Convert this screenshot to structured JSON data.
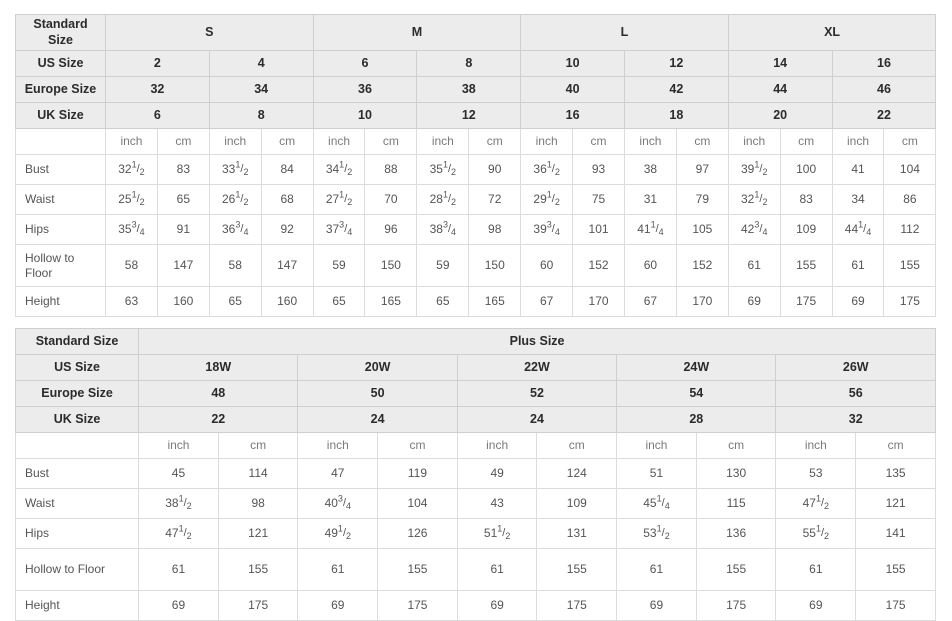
{
  "tables": [
    {
      "id": "standard-size-table",
      "row_label_header": "Standard Size",
      "groups": [
        {
          "label": "S",
          "span": 4
        },
        {
          "label": "M",
          "span": 4
        },
        {
          "label": "L",
          "span": 4
        },
        {
          "label": "XL",
          "span": 4
        }
      ],
      "size_rows": [
        {
          "label": "US Size",
          "values": [
            "2",
            "4",
            "6",
            "8",
            "10",
            "12",
            "14",
            "16"
          ]
        },
        {
          "label": "Europe Size",
          "values": [
            "32",
            "34",
            "36",
            "38",
            "40",
            "42",
            "44",
            "46"
          ]
        },
        {
          "label": "UK Size",
          "values": [
            "6",
            "8",
            "10",
            "12",
            "16",
            "18",
            "20",
            "22"
          ]
        }
      ],
      "units": [
        "inch",
        "cm",
        "inch",
        "cm",
        "inch",
        "cm",
        "inch",
        "cm",
        "inch",
        "cm",
        "inch",
        "cm",
        "inch",
        "cm",
        "inch",
        "cm"
      ],
      "measure_rows": [
        {
          "label": "Bust",
          "values": [
            {
              "w": "32",
              "n": "1",
              "d": "2"
            },
            {
              "w": "83"
            },
            {
              "w": "33",
              "n": "1",
              "d": "2"
            },
            {
              "w": "84"
            },
            {
              "w": "34",
              "n": "1",
              "d": "2"
            },
            {
              "w": "88"
            },
            {
              "w": "35",
              "n": "1",
              "d": "2"
            },
            {
              "w": "90"
            },
            {
              "w": "36",
              "n": "1",
              "d": "2"
            },
            {
              "w": "93"
            },
            {
              "w": "38"
            },
            {
              "w": "97"
            },
            {
              "w": "39",
              "n": "1",
              "d": "2"
            },
            {
              "w": "100"
            },
            {
              "w": "41"
            },
            {
              "w": "104"
            }
          ]
        },
        {
          "label": "Waist",
          "values": [
            {
              "w": "25",
              "n": "1",
              "d": "2"
            },
            {
              "w": "65"
            },
            {
              "w": "26",
              "n": "1",
              "d": "2"
            },
            {
              "w": "68"
            },
            {
              "w": "27",
              "n": "1",
              "d": "2"
            },
            {
              "w": "70"
            },
            {
              "w": "28",
              "n": "1",
              "d": "2"
            },
            {
              "w": "72"
            },
            {
              "w": "29",
              "n": "1",
              "d": "2"
            },
            {
              "w": "75"
            },
            {
              "w": "31"
            },
            {
              "w": "79"
            },
            {
              "w": "32",
              "n": "1",
              "d": "2"
            },
            {
              "w": "83"
            },
            {
              "w": "34"
            },
            {
              "w": "86"
            }
          ]
        },
        {
          "label": "Hips",
          "values": [
            {
              "w": "35",
              "n": "3",
              "d": "4"
            },
            {
              "w": "91"
            },
            {
              "w": "36",
              "n": "3",
              "d": "4"
            },
            {
              "w": "92"
            },
            {
              "w": "37",
              "n": "3",
              "d": "4"
            },
            {
              "w": "96"
            },
            {
              "w": "38",
              "n": "3",
              "d": "4"
            },
            {
              "w": "98"
            },
            {
              "w": "39",
              "n": "3",
              "d": "4"
            },
            {
              "w": "101"
            },
            {
              "w": "41",
              "n": "1",
              "d": "4"
            },
            {
              "w": "105"
            },
            {
              "w": "42",
              "n": "3",
              "d": "4"
            },
            {
              "w": "109"
            },
            {
              "w": "44",
              "n": "1",
              "d": "4"
            },
            {
              "w": "112"
            }
          ]
        },
        {
          "label": "Hollow to Floor",
          "tall": true,
          "values": [
            {
              "w": "58"
            },
            {
              "w": "147"
            },
            {
              "w": "58"
            },
            {
              "w": "147"
            },
            {
              "w": "59"
            },
            {
              "w": "150"
            },
            {
              "w": "59"
            },
            {
              "w": "150"
            },
            {
              "w": "60"
            },
            {
              "w": "152"
            },
            {
              "w": "60"
            },
            {
              "w": "152"
            },
            {
              "w": "61"
            },
            {
              "w": "155"
            },
            {
              "w": "61"
            },
            {
              "w": "155"
            }
          ]
        },
        {
          "label": "Height",
          "values": [
            {
              "w": "63"
            },
            {
              "w": "160"
            },
            {
              "w": "65"
            },
            {
              "w": "160"
            },
            {
              "w": "65"
            },
            {
              "w": "165"
            },
            {
              "w": "65"
            },
            {
              "w": "165"
            },
            {
              "w": "67"
            },
            {
              "w": "170"
            },
            {
              "w": "67"
            },
            {
              "w": "170"
            },
            {
              "w": "69"
            },
            {
              "w": "175"
            },
            {
              "w": "69"
            },
            {
              "w": "175"
            }
          ]
        }
      ]
    },
    {
      "id": "plus-size-table",
      "row_label_header": "Standard Size",
      "group_title": "Plus Size",
      "size_rows": [
        {
          "label": "US Size",
          "values": [
            "18W",
            "20W",
            "22W",
            "24W",
            "26W"
          ]
        },
        {
          "label": "Europe Size",
          "values": [
            "48",
            "50",
            "52",
            "54",
            "56"
          ]
        },
        {
          "label": "UK Size",
          "values": [
            "22",
            "24",
            "24",
            "28",
            "32"
          ]
        }
      ],
      "units": [
        "inch",
        "cm",
        "inch",
        "cm",
        "inch",
        "cm",
        "inch",
        "cm",
        "inch",
        "cm"
      ],
      "measure_rows": [
        {
          "label": "Bust",
          "values": [
            {
              "w": "45"
            },
            {
              "w": "114"
            },
            {
              "w": "47"
            },
            {
              "w": "119"
            },
            {
              "w": "49"
            },
            {
              "w": "124"
            },
            {
              "w": "51"
            },
            {
              "w": "130"
            },
            {
              "w": "53"
            },
            {
              "w": "135"
            }
          ]
        },
        {
          "label": "Waist",
          "values": [
            {
              "w": "38",
              "n": "1",
              "d": "2"
            },
            {
              "w": "98"
            },
            {
              "w": "40",
              "n": "3",
              "d": "4"
            },
            {
              "w": "104"
            },
            {
              "w": "43"
            },
            {
              "w": "109"
            },
            {
              "w": "45",
              "n": "1",
              "d": "4"
            },
            {
              "w": "115"
            },
            {
              "w": "47",
              "n": "1",
              "d": "2"
            },
            {
              "w": "121"
            }
          ]
        },
        {
          "label": "Hips",
          "values": [
            {
              "w": "47",
              "n": "1",
              "d": "2"
            },
            {
              "w": "121"
            },
            {
              "w": "49",
              "n": "1",
              "d": "2"
            },
            {
              "w": "126"
            },
            {
              "w": "51",
              "n": "1",
              "d": "2"
            },
            {
              "w": "131"
            },
            {
              "w": "53",
              "n": "1",
              "d": "2"
            },
            {
              "w": "136"
            },
            {
              "w": "55",
              "n": "1",
              "d": "2"
            },
            {
              "w": "141"
            }
          ]
        },
        {
          "label": "Hollow to Floor",
          "tall": true,
          "values": [
            {
              "w": "61"
            },
            {
              "w": "155"
            },
            {
              "w": "61"
            },
            {
              "w": "155"
            },
            {
              "w": "61"
            },
            {
              "w": "155"
            },
            {
              "w": "61"
            },
            {
              "w": "155"
            },
            {
              "w": "61"
            },
            {
              "w": "155"
            }
          ]
        },
        {
          "label": "Height",
          "values": [
            {
              "w": "69"
            },
            {
              "w": "175"
            },
            {
              "w": "69"
            },
            {
              "w": "175"
            },
            {
              "w": "69"
            },
            {
              "w": "175"
            },
            {
              "w": "69"
            },
            {
              "w": "175"
            },
            {
              "w": "69"
            },
            {
              "w": "175"
            }
          ]
        }
      ]
    }
  ],
  "colors": {
    "header_bg": "#ececec",
    "body_bg": "#ffffff",
    "border": "#dcdcdc",
    "outer_border": "#c9c9c9",
    "header_text": "#2b2b2b",
    "body_text": "#555555"
  }
}
